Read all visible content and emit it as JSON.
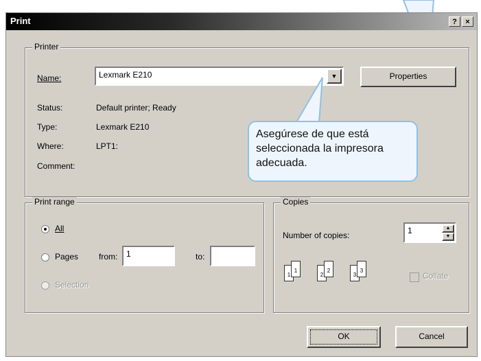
{
  "window": {
    "title": "Print",
    "help_btn": "?",
    "close_btn": "×"
  },
  "printer_group": {
    "legend": "Printer",
    "name_label": "Name:",
    "name_value": "Lexmark E210",
    "properties_btn": "Properties",
    "status_label": "Status:",
    "status_value": "Default printer; Ready",
    "type_label": "Type:",
    "type_value": "Lexmark E210",
    "where_label": "Where:",
    "where_value": "LPT1:",
    "comment_label": "Comment:"
  },
  "callout": {
    "text": "Asegúrese de que está seleccionada la impresora adecuada."
  },
  "print_range": {
    "legend": "Print range",
    "all_label": "All",
    "pages_label": "Pages",
    "from_label": "from:",
    "from_value": "1",
    "to_label": "to:",
    "to_value": "",
    "selection_label": "Selection",
    "selected_option": "All"
  },
  "copies": {
    "legend": "Copies",
    "number_label": "Number of copies:",
    "number_value": "1",
    "collate_label": "Collate",
    "collate_checked": false,
    "collate_icon_pages": [
      "1",
      "1",
      "2",
      "2",
      "3",
      "3"
    ]
  },
  "buttons": {
    "ok": "OK",
    "cancel": "Cancel"
  },
  "colors": {
    "dialog_bg": "#d4d0c8",
    "callout_bg": "#eef5fc",
    "callout_border": "#8fc0e8"
  }
}
